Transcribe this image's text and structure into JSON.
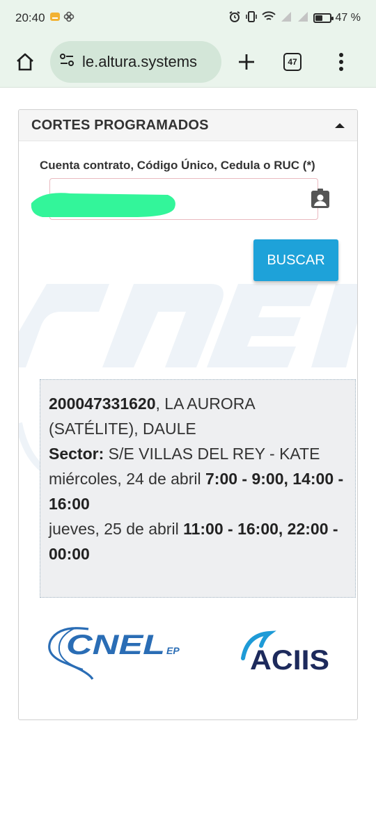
{
  "status_bar": {
    "time": "20:40",
    "battery": "47 %",
    "battery_level": 0.47
  },
  "browser": {
    "url": "le.altura.systems",
    "tab_count": "47",
    "icons": [
      "home-icon",
      "site-settings-icon",
      "new-tab-plus-icon",
      "tab-switcher-icon",
      "overflow-menu-icon"
    ]
  },
  "card": {
    "title": "CORTES PROGRAMADOS",
    "field_label": "Cuenta contrato, Código Único, Cedula o RUC (*)",
    "input_value": "",
    "search_button": "BUSCAR"
  },
  "result": {
    "account": "200047331620",
    "location": ", LA AURORA (SATÉLITE), DAULE",
    "sector_label": "Sector:",
    "sector_value": " S/E VILLAS DEL REY - KATE",
    "day1_date": "miércoles, 24 de abril ",
    "day1_times": "7:00 - 9:00, 14:00 - 16:00",
    "day2_date": "jueves, 25 de abril ",
    "day2_times": "11:00 - 16:00, 22:00 - 00:00"
  },
  "logos": {
    "cnel": "CNEL",
    "cnel_suffix": "EP",
    "aciis": "ACIIS"
  },
  "colors": {
    "button": "#1ea2d9",
    "browser_chrome": "#eaf4ec",
    "url_pill": "#d3e6d8",
    "redaction": "#33f59a",
    "cnel_blue": "#2a6db5",
    "aciis_navy": "#1d2a5c"
  }
}
